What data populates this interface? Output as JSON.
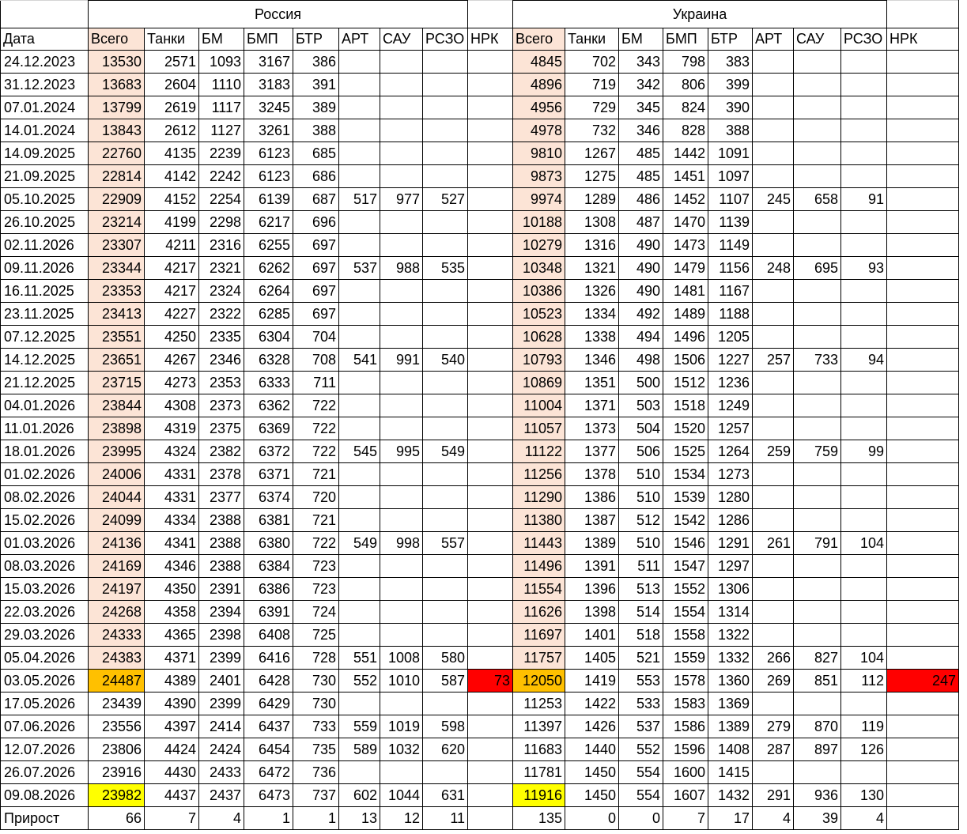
{
  "groups": {
    "left": "Россия",
    "right": "Украина"
  },
  "headers": [
    "Дата",
    "Всего",
    "Танки",
    "БМ",
    "БМП",
    "БТР",
    "АРТ",
    "САУ",
    "РСЗО",
    "НРК",
    "Всего",
    "Танки",
    "БМ",
    "БМП",
    "БТР",
    "АРТ",
    "САУ",
    "РСЗО",
    "НРК"
  ],
  "rows": [
    {
      "date": "24.12.2023",
      "ru": [
        "13530",
        "2571",
        "1093",
        "3167",
        "386",
        "",
        "",
        "",
        ""
      ],
      "ua": [
        "4845",
        "702",
        "343",
        "798",
        "383",
        "",
        "",
        "",
        ""
      ]
    },
    {
      "date": "31.12.2023",
      "ru": [
        "13683",
        "2604",
        "1110",
        "3183",
        "391",
        "",
        "",
        "",
        ""
      ],
      "ua": [
        "4896",
        "719",
        "342",
        "806",
        "399",
        "",
        "",
        "",
        ""
      ]
    },
    {
      "date": "07.01.2024",
      "ru": [
        "13799",
        "2619",
        "1117",
        "3245",
        "389",
        "",
        "",
        "",
        ""
      ],
      "ua": [
        "4956",
        "729",
        "345",
        "824",
        "390",
        "",
        "",
        "",
        ""
      ]
    },
    {
      "date": "14.01.2024",
      "ru": [
        "13843",
        "2612",
        "1127",
        "3261",
        "388",
        "",
        "",
        "",
        ""
      ],
      "ua": [
        "4978",
        "732",
        "346",
        "828",
        "388",
        "",
        "",
        "",
        ""
      ]
    },
    {
      "date": "14.09.2025",
      "ru": [
        "22760",
        "4135",
        "2239",
        "6123",
        "685",
        "",
        "",
        "",
        ""
      ],
      "ua": [
        "9810",
        "1267",
        "485",
        "1442",
        "1091",
        "",
        "",
        "",
        ""
      ]
    },
    {
      "date": "21.09.2025",
      "ru": [
        "22814",
        "4142",
        "2242",
        "6123",
        "686",
        "",
        "",
        "",
        ""
      ],
      "ua": [
        "9873",
        "1275",
        "485",
        "1451",
        "1097",
        "",
        "",
        "",
        ""
      ]
    },
    {
      "date": "05.10.2025",
      "ru": [
        "22909",
        "4152",
        "2254",
        "6139",
        "687",
        "517",
        "977",
        "527",
        ""
      ],
      "ua": [
        "9974",
        "1289",
        "486",
        "1452",
        "1107",
        "245",
        "658",
        "91",
        ""
      ]
    },
    {
      "date": "26.10.2025",
      "ru": [
        "23214",
        "4199",
        "2298",
        "6217",
        "696",
        "",
        "",
        "",
        ""
      ],
      "ua": [
        "10188",
        "1308",
        "487",
        "1470",
        "1139",
        "",
        "",
        "",
        ""
      ]
    },
    {
      "date": "02.11.2026",
      "ru": [
        "23307",
        "4211",
        "2316",
        "6255",
        "697",
        "",
        "",
        "",
        ""
      ],
      "ua": [
        "10279",
        "1316",
        "490",
        "1473",
        "1149",
        "",
        "",
        "",
        ""
      ]
    },
    {
      "date": "09.11.2026",
      "ru": [
        "23344",
        "4217",
        "2321",
        "6262",
        "697",
        "537",
        "988",
        "535",
        ""
      ],
      "ua": [
        "10348",
        "1321",
        "490",
        "1479",
        "1156",
        "248",
        "695",
        "93",
        ""
      ]
    },
    {
      "date": "16.11.2025",
      "ru": [
        "23353",
        "4217",
        "2324",
        "6264",
        "697",
        "",
        "",
        "",
        ""
      ],
      "ua": [
        "10386",
        "1326",
        "490",
        "1481",
        "1167",
        "",
        "",
        "",
        ""
      ]
    },
    {
      "date": "23.11.2025",
      "ru": [
        "23413",
        "4227",
        "2322",
        "6285",
        "697",
        "",
        "",
        "",
        ""
      ],
      "ua": [
        "10523",
        "1334",
        "492",
        "1489",
        "1188",
        "",
        "",
        "",
        ""
      ]
    },
    {
      "date": "07.12.2025",
      "ru": [
        "23551",
        "4250",
        "2335",
        "6304",
        "704",
        "",
        "",
        "",
        ""
      ],
      "ua": [
        "10628",
        "1338",
        "494",
        "1496",
        "1205",
        "",
        "",
        "",
        ""
      ]
    },
    {
      "date": "14.12.2025",
      "ru": [
        "23651",
        "4267",
        "2346",
        "6328",
        "708",
        "541",
        "991",
        "540",
        ""
      ],
      "ua": [
        "10793",
        "1346",
        "498",
        "1506",
        "1227",
        "257",
        "733",
        "94",
        ""
      ]
    },
    {
      "date": "21.12.2025",
      "ru": [
        "23715",
        "4273",
        "2353",
        "6333",
        "711",
        "",
        "",
        "",
        ""
      ],
      "ua": [
        "10869",
        "1351",
        "500",
        "1512",
        "1236",
        "",
        "",
        "",
        ""
      ]
    },
    {
      "date": "04.01.2026",
      "ru": [
        "23844",
        "4308",
        "2373",
        "6362",
        "722",
        "",
        "",
        "",
        ""
      ],
      "ua": [
        "11004",
        "1371",
        "503",
        "1518",
        "1249",
        "",
        "",
        "",
        ""
      ]
    },
    {
      "date": "11.01.2026",
      "ru": [
        "23898",
        "4319",
        "2375",
        "6369",
        "722",
        "",
        "",
        "",
        ""
      ],
      "ua": [
        "11057",
        "1373",
        "504",
        "1520",
        "1257",
        "",
        "",
        "",
        ""
      ]
    },
    {
      "date": "18.01.2026",
      "ru": [
        "23995",
        "4324",
        "2382",
        "6372",
        "722",
        "545",
        "995",
        "549",
        ""
      ],
      "ua": [
        "11122",
        "1377",
        "506",
        "1525",
        "1264",
        "259",
        "759",
        "99",
        ""
      ]
    },
    {
      "date": "01.02.2026",
      "ru": [
        "24006",
        "4331",
        "2378",
        "6371",
        "721",
        "",
        "",
        "",
        ""
      ],
      "ua": [
        "11256",
        "1378",
        "510",
        "1534",
        "1273",
        "",
        "",
        "",
        ""
      ]
    },
    {
      "date": "08.02.2026",
      "ru": [
        "24044",
        "4331",
        "2377",
        "6374",
        "720",
        "",
        "",
        "",
        ""
      ],
      "ua": [
        "11290",
        "1386",
        "510",
        "1539",
        "1280",
        "",
        "",
        "",
        ""
      ]
    },
    {
      "date": "15.02.2026",
      "ru": [
        "24099",
        "4334",
        "2388",
        "6381",
        "721",
        "",
        "",
        "",
        ""
      ],
      "ua": [
        "11380",
        "1387",
        "512",
        "1542",
        "1286",
        "",
        "",
        "",
        ""
      ]
    },
    {
      "date": "01.03.2026",
      "ru": [
        "24136",
        "4341",
        "2388",
        "6380",
        "722",
        "549",
        "998",
        "557",
        ""
      ],
      "ua": [
        "11443",
        "1389",
        "510",
        "1546",
        "1291",
        "261",
        "791",
        "104",
        ""
      ]
    },
    {
      "date": "08.03.2026",
      "ru": [
        "24169",
        "4346",
        "2388",
        "6384",
        "723",
        "",
        "",
        "",
        ""
      ],
      "ua": [
        "11496",
        "1391",
        "511",
        "1547",
        "1297",
        "",
        "",
        "",
        ""
      ]
    },
    {
      "date": "15.03.2026",
      "ru": [
        "24197",
        "4350",
        "2391",
        "6386",
        "723",
        "",
        "",
        "",
        ""
      ],
      "ua": [
        "11554",
        "1396",
        "513",
        "1552",
        "1306",
        "",
        "",
        "",
        ""
      ]
    },
    {
      "date": "22.03.2026",
      "ru": [
        "24268",
        "4358",
        "2394",
        "6391",
        "724",
        "",
        "",
        "",
        ""
      ],
      "ua": [
        "11626",
        "1398",
        "514",
        "1554",
        "1314",
        "",
        "",
        "",
        ""
      ]
    },
    {
      "date": "29.03.2026",
      "ru": [
        "24333",
        "4365",
        "2398",
        "6408",
        "725",
        "",
        "",
        "",
        ""
      ],
      "ua": [
        "11697",
        "1401",
        "518",
        "1558",
        "1322",
        "",
        "",
        "",
        ""
      ]
    },
    {
      "date": "05.04.2026",
      "ru": [
        "24383",
        "4371",
        "2399",
        "6416",
        "728",
        "551",
        "1008",
        "580",
        ""
      ],
      "ua": [
        "11757",
        "1405",
        "521",
        "1559",
        "1332",
        "266",
        "827",
        "104",
        ""
      ]
    },
    {
      "date": "03.05.2026",
      "ru": [
        "24487",
        "4389",
        "2401",
        "6428",
        "730",
        "552",
        "1010",
        "587",
        "73"
      ],
      "ua": [
        "12050",
        "1419",
        "553",
        "1578",
        "1360",
        "269",
        "851",
        "112",
        "247"
      ],
      "highlight": "orange",
      "nrk_red": true
    },
    {
      "date": "17.05.2026",
      "ru": [
        "23439",
        "4390",
        "2399",
        "6429",
        "730",
        "",
        "",
        "",
        ""
      ],
      "ua": [
        "11253",
        "1422",
        "533",
        "1583",
        "1369",
        "",
        "",
        "",
        ""
      ],
      "plain_total": true
    },
    {
      "date": "07.06.2026",
      "ru": [
        "23556",
        "4397",
        "2414",
        "6437",
        "733",
        "559",
        "1019",
        "598",
        ""
      ],
      "ua": [
        "11397",
        "1426",
        "537",
        "1586",
        "1389",
        "279",
        "870",
        "119",
        ""
      ],
      "plain_total": true
    },
    {
      "date": "12.07.2026",
      "ru": [
        "23806",
        "4424",
        "2424",
        "6454",
        "735",
        "589",
        "1032",
        "620",
        ""
      ],
      "ua": [
        "11683",
        "1440",
        "552",
        "1596",
        "1408",
        "287",
        "897",
        "126",
        ""
      ],
      "plain_total": true
    },
    {
      "date": "26.07.2026",
      "ru": [
        "23916",
        "4430",
        "2433",
        "6472",
        "736",
        "",
        "",
        "",
        ""
      ],
      "ua": [
        "11781",
        "1450",
        "554",
        "1600",
        "1415",
        "",
        "",
        "",
        ""
      ],
      "plain_total": true
    },
    {
      "date": "09.08.2026",
      "ru": [
        "23982",
        "4437",
        "2437",
        "6473",
        "737",
        "602",
        "1044",
        "631",
        ""
      ],
      "ua": [
        "11916",
        "1450",
        "554",
        "1607",
        "1432",
        "291",
        "936",
        "130",
        ""
      ],
      "highlight": "yellow"
    }
  ],
  "growth": {
    "label": "Прирост",
    "ru": [
      "66",
      "7",
      "4",
      "1",
      "1",
      "13",
      "12",
      "11",
      ""
    ],
    "ua": [
      "135",
      "0",
      "0",
      "7",
      "17",
      "4",
      "39",
      "4",
      ""
    ]
  },
  "colors": {
    "total_fill": "#fce4d6",
    "orange": "#ffc000",
    "yellow": "#ffff00",
    "red": "#ff0000"
  }
}
